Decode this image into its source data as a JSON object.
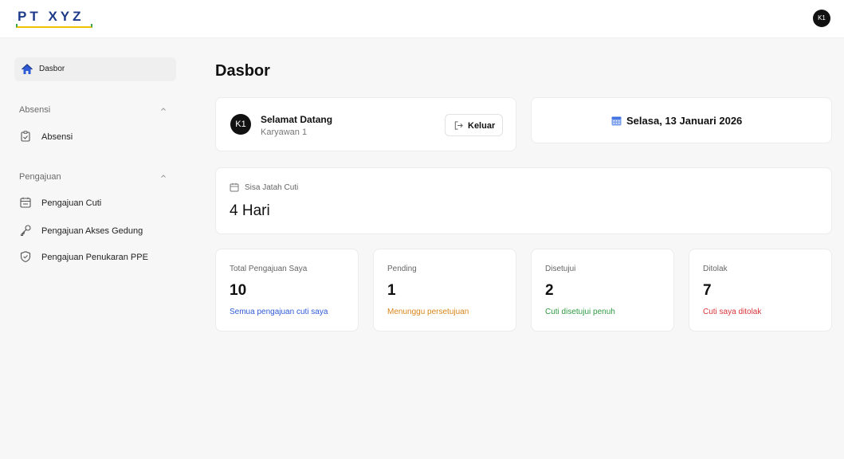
{
  "header": {
    "logo": "PT XYZ",
    "avatar": "K1"
  },
  "sidebar": {
    "dashboard": "Dasbor",
    "groups": [
      {
        "title": "Absensi",
        "items": [
          {
            "label": "Absensi",
            "icon": "clipboard-icon"
          }
        ]
      },
      {
        "title": "Pengajuan",
        "items": [
          {
            "label": "Pengajuan Cuti",
            "icon": "calendar-icon"
          },
          {
            "label": "Pengajuan Akses Gedung",
            "icon": "key-icon"
          },
          {
            "label": "Pengajuan Penukaran PPE",
            "icon": "shield-icon"
          }
        ]
      }
    ]
  },
  "main": {
    "title": "Dasbor",
    "welcome": {
      "avatar": "K1",
      "greeting": "Selamat Datang",
      "name": "Karyawan 1",
      "logout_label": "Keluar"
    },
    "date": "Selasa, 13 Januari 2026",
    "leave": {
      "label": "Sisa Jatah Cuti",
      "value": "4 Hari"
    },
    "stats": [
      {
        "label": "Total Pengajuan Saya",
        "value": "10",
        "desc": "Semua pengajuan cuti saya",
        "color": "#2f5bd6"
      },
      {
        "label": "Pending",
        "value": "1",
        "desc": "Menunggu persetujuan",
        "color": "#d9861a"
      },
      {
        "label": "Disetujui",
        "value": "2",
        "desc": "Cuti disetujui penuh",
        "color": "#2f9a43"
      },
      {
        "label": "Ditolak",
        "value": "7",
        "desc": "Cuti saya ditolak",
        "color": "#d8343a"
      }
    ]
  },
  "colors": {
    "brand": "#1e3a8a",
    "accent_blue": "#2f5bd6",
    "pending": "#d9861a",
    "approved": "#2f9a43",
    "rejected": "#d8343a"
  }
}
